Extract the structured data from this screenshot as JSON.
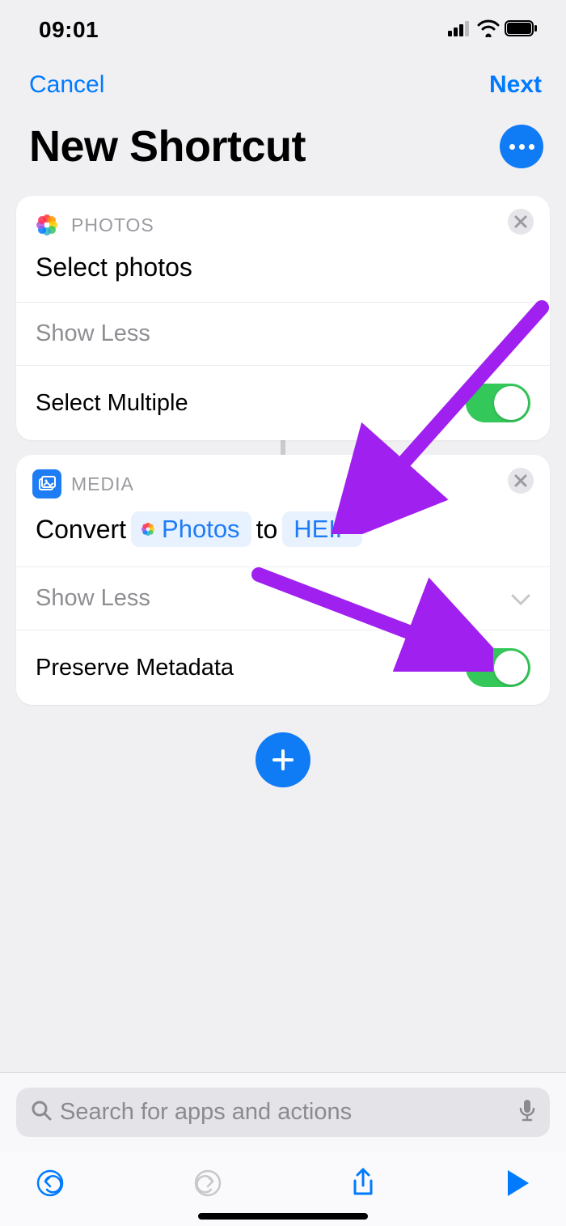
{
  "status": {
    "time": "09:01"
  },
  "nav": {
    "cancel": "Cancel",
    "next": "Next"
  },
  "title": "New Shortcut",
  "cards": [
    {
      "app": "PHOTOS",
      "action_prefix": "Select photos",
      "show_less": "Show Less",
      "option_label": "Select Multiple",
      "toggle_on": true
    },
    {
      "app": "MEDIA",
      "convert_word": "Convert",
      "convert_token_1": "Photos",
      "convert_to": "to",
      "convert_token_2": "HEIF",
      "show_less": "Show Less",
      "option_label": "Preserve Metadata",
      "toggle_on": true
    }
  ],
  "search": {
    "placeholder": "Search for apps and actions"
  }
}
